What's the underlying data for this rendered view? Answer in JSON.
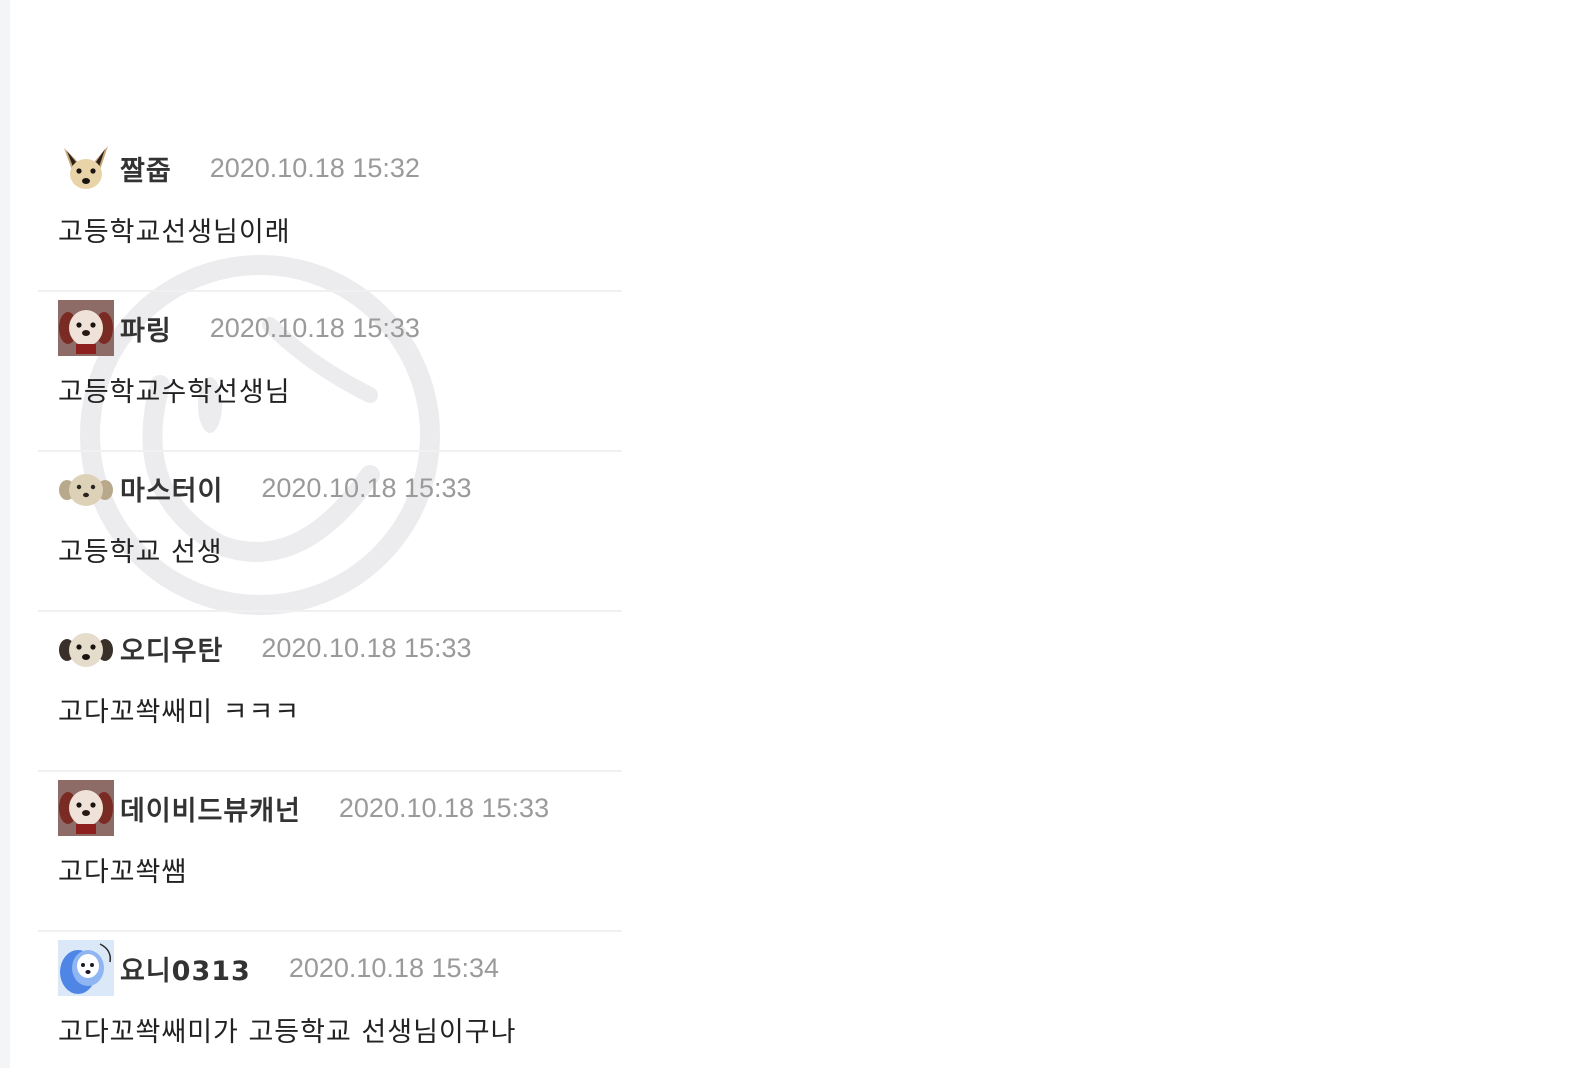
{
  "comments": [
    {
      "nickname": "짤줍",
      "timestamp": "2020.10.18 15:32",
      "text": "고등학교선생님이래",
      "avatar": "fennec-fox-avatar"
    },
    {
      "nickname": "파링",
      "timestamp": "2020.10.18 15:33",
      "text": "고등학교수학선생님",
      "avatar": "red-dog-avatar"
    },
    {
      "nickname": "마스터이",
      "timestamp": "2020.10.18 15:33",
      "text": "고등학교 선생",
      "avatar": "beige-puppy-avatar"
    },
    {
      "nickname": "오디우탄",
      "timestamp": "2020.10.18 15:33",
      "text": "고다꼬쏵쌔미 ㅋㅋㅋ",
      "avatar": "beige-puppy-avatar"
    },
    {
      "nickname": "데이비드뷰캐넌",
      "timestamp": "2020.10.18 15:33",
      "text": "고다꼬쏵쌤",
      "avatar": "red-dog-avatar"
    },
    {
      "nickname": "요니0313",
      "timestamp": "2020.10.18 15:34",
      "text": "고다꼬쏵쌔미가 고등학교 선생님이구나",
      "avatar": "blue-dog-avatar"
    }
  ]
}
